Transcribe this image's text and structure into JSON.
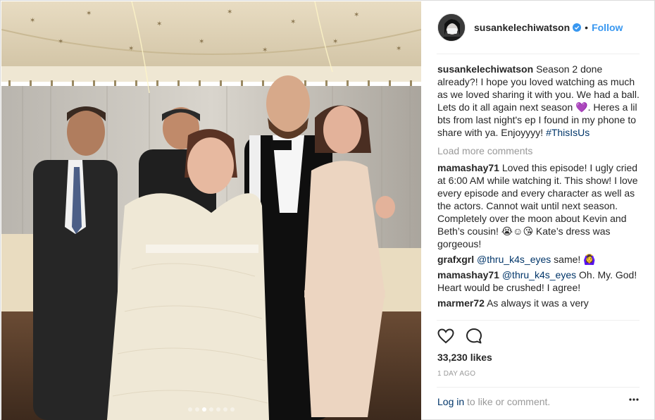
{
  "post": {
    "username": "susankelechiwatson",
    "bullet": "•",
    "follow_label": "Follow",
    "caption": {
      "user": "susankelechiwatson",
      "text_1": "Season 2 done already?! I hope you loved watching as much as we loved sharing it with you. We had a ball. Lets do it all again next season ",
      "emoji": "💜",
      "text_2": ". Heres a lil bts from last night's ep I found in my phone to share with ya. Enjoyyyy! ",
      "hashtag": "#ThisIsUs"
    },
    "load_more": "Load more comments",
    "comments": [
      {
        "user": "mamashay71",
        "text": "Loved this episode! I ugly cried at 6:00 AM while watching it. This show! I love every episode and every character as well as the actors. Cannot wait until next season. Completely over the moon about Kevin and Beth’s cousin! 😭☺😘 Kate’s dress was gorgeous!"
      },
      {
        "user": "grafxgrl",
        "mention": "@thru_k4s_eyes",
        "text": " same! 🙆‍♀"
      },
      {
        "user": "mamashay71",
        "mention": "@thru_k4s_eyes",
        "text": " Oh. My. God! Heart would be crushed! I agree!"
      },
      {
        "user": "marmer72",
        "text": "As always it was a very"
      }
    ],
    "likes": "33,230 likes",
    "time": "1 DAY AGO",
    "login_link": "Log in",
    "login_rest": " to like or comment.",
    "carousel": {
      "count": 7,
      "active_index": 2
    },
    "icons": {
      "like": "heart-icon",
      "comment": "comment-icon",
      "verified": "verified-badge-icon",
      "more": "more-options-icon"
    },
    "colors": {
      "link_blue": "#3897f0",
      "dark_link": "#003569",
      "muted": "#999999",
      "text": "#262626"
    }
  }
}
